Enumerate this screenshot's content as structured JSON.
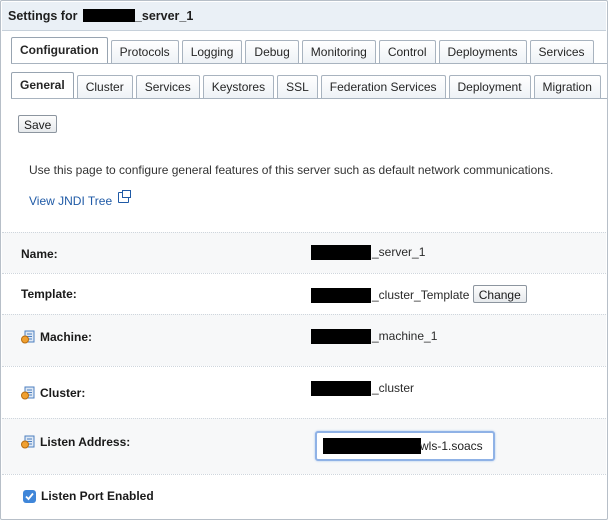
{
  "title": {
    "prefix": "Settings for ",
    "suffix": "_server_1"
  },
  "primary_tabs": [
    "Configuration",
    "Protocols",
    "Logging",
    "Debug",
    "Monitoring",
    "Control",
    "Deployments",
    "Services"
  ],
  "secondary_tabs": [
    "General",
    "Cluster",
    "Services",
    "Keystores",
    "SSL",
    "Federation Services",
    "Deployment",
    "Migration"
  ],
  "toolbar": {
    "save_label": "Save"
  },
  "intro": {
    "text": "Use this page to configure general features of this server such as default network communications.",
    "jndi_link": "View JNDI Tree"
  },
  "fields": {
    "name": {
      "label": "Name:",
      "value": "_server_1"
    },
    "template": {
      "label": "Template:",
      "value": "_cluster_Template",
      "change_label": "Change"
    },
    "machine": {
      "label": "Machine:",
      "value": "_machine_1"
    },
    "cluster": {
      "label": "Cluster:",
      "value": "_cluster"
    },
    "listen_address": {
      "label": "Listen Address:",
      "value": "wls-1.soacs"
    },
    "listen_port_enabled": {
      "label": "Listen Port Enabled",
      "checked": true
    }
  },
  "icons": [
    "external-link-icon",
    "config-help-icon",
    "checkbox-check-icon"
  ],
  "colors": {
    "link": "#1f5aa6",
    "tab_border": "#a8b3bf",
    "checkbox": "#3f86d9",
    "focus_ring": "#8fb2e6"
  }
}
